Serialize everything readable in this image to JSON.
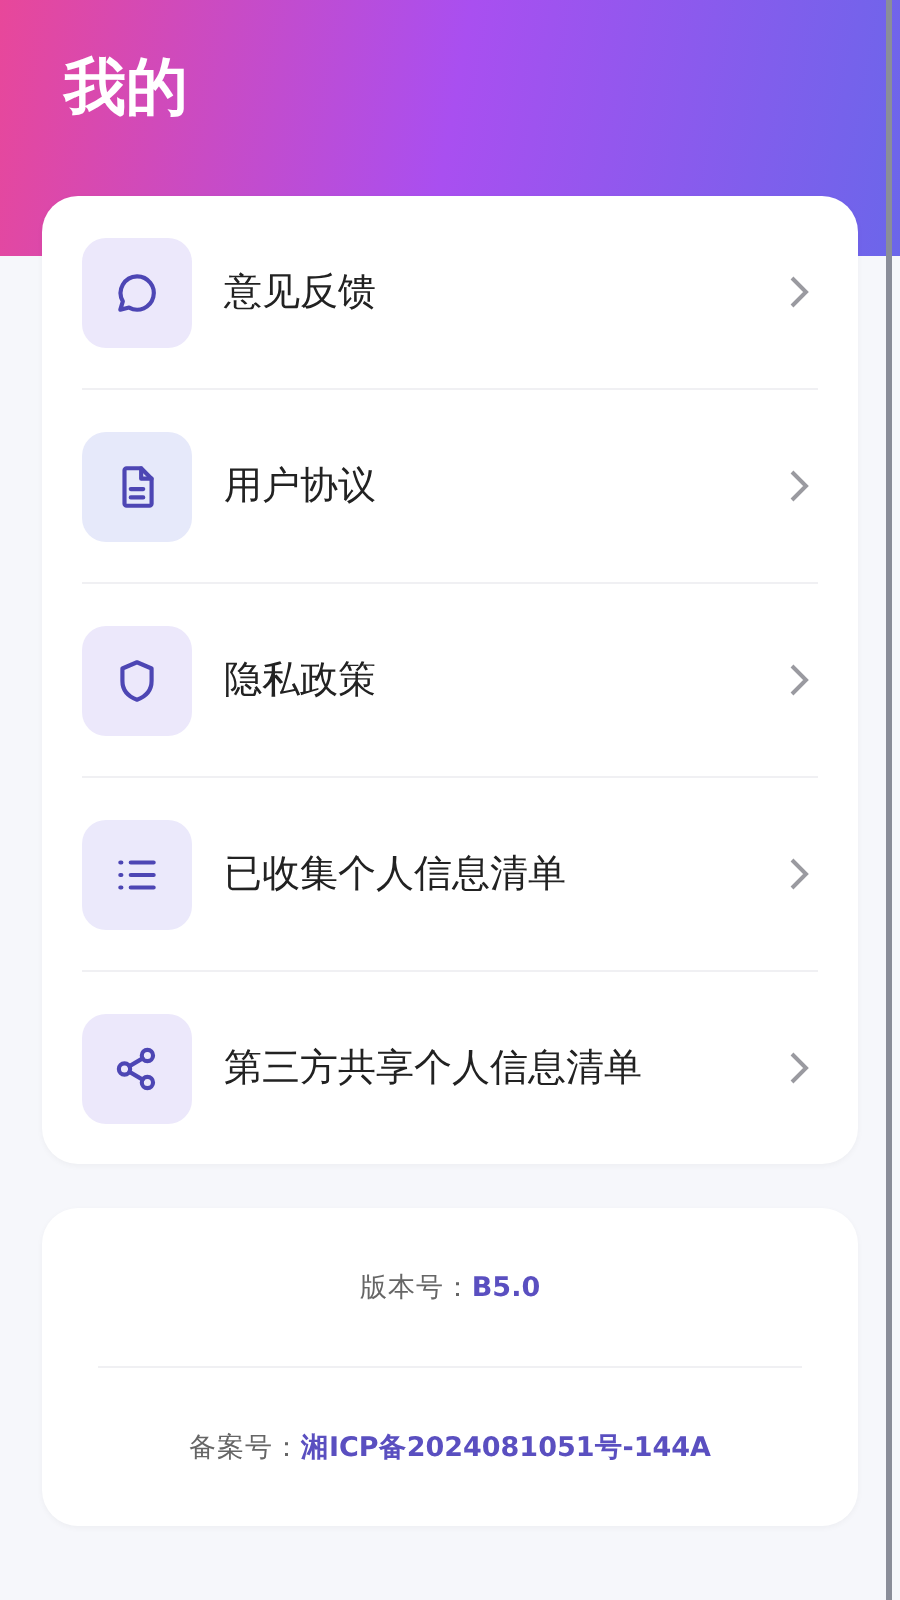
{
  "header": {
    "title": "我的"
  },
  "menu": [
    {
      "kind": "chat",
      "label": "意见反馈"
    },
    {
      "kind": "document",
      "label": "用户协议"
    },
    {
      "kind": "shield",
      "label": "隐私政策"
    },
    {
      "kind": "list",
      "label": "已收集个人信息清单"
    },
    {
      "kind": "share",
      "label": "第三方共享个人信息清单"
    }
  ],
  "info": [
    {
      "label": "版本号：",
      "value": "B5.0"
    },
    {
      "label": "备案号：",
      "value": "湘ICP备2024081051号-144A"
    }
  ]
}
